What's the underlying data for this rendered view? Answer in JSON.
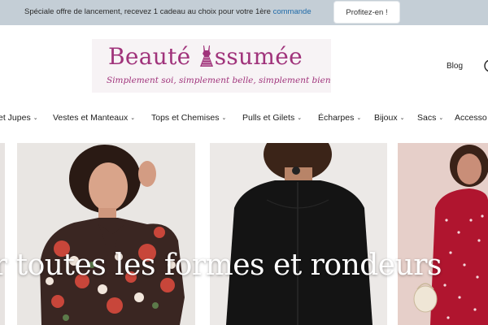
{
  "announcement": {
    "text": "Spéciale offre de lancement, recevez 1 cadeau au choix pour votre 1ère ",
    "link": "commande",
    "button": "Profitez-en !"
  },
  "header": {
    "logo_title_part1": "Beauté",
    "logo_title_part2": "ssumée",
    "logo_tagline": "Simplement soi, simplement belle, simplement bien",
    "blog": "Blog"
  },
  "nav": {
    "items": [
      {
        "label": "et Jupes"
      },
      {
        "label": "Vestes et Manteaux"
      },
      {
        "label": "Tops et Chemises"
      },
      {
        "label": "Pulls et Gilets"
      },
      {
        "label": "Écharpes"
      },
      {
        "label": "Bijoux"
      },
      {
        "label": "Sacs"
      },
      {
        "label": "Accesso"
      }
    ]
  },
  "hero": {
    "text": "r toutes les formes et rondeurs"
  },
  "colors": {
    "brand": "#a0337b",
    "announce_bg": "#c4ced6",
    "logo_bg": "#f7f3f5",
    "link": "#1f6aa8"
  }
}
